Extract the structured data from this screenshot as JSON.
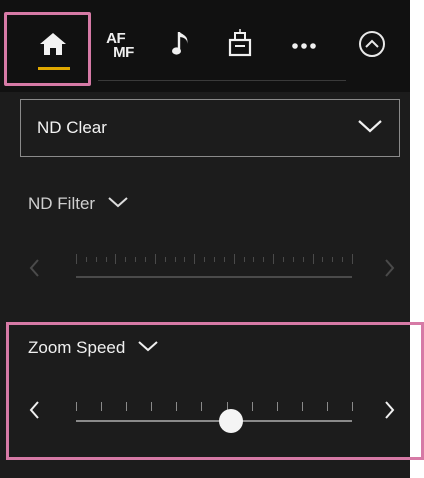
{
  "tabs": [
    {
      "name": "home",
      "icon": "home-icon",
      "active": true
    },
    {
      "name": "af-mf",
      "label_top": "AF",
      "label_bottom": "MF"
    },
    {
      "name": "audio",
      "icon": "music-note-icon"
    },
    {
      "name": "media",
      "icon": "media-slot-icon"
    },
    {
      "name": "more",
      "icon": "more-dots-icon"
    },
    {
      "name": "collapse",
      "icon": "chevron-up-circle-icon"
    }
  ],
  "nd_mode": {
    "value": "ND Clear"
  },
  "nd_filter": {
    "label": "ND Filter",
    "enabled": false
  },
  "zoom_speed": {
    "label": "Zoom Speed",
    "value_fraction": 0.56
  },
  "colors": {
    "accent": "#e0a800",
    "highlight": "#d67aa6"
  }
}
